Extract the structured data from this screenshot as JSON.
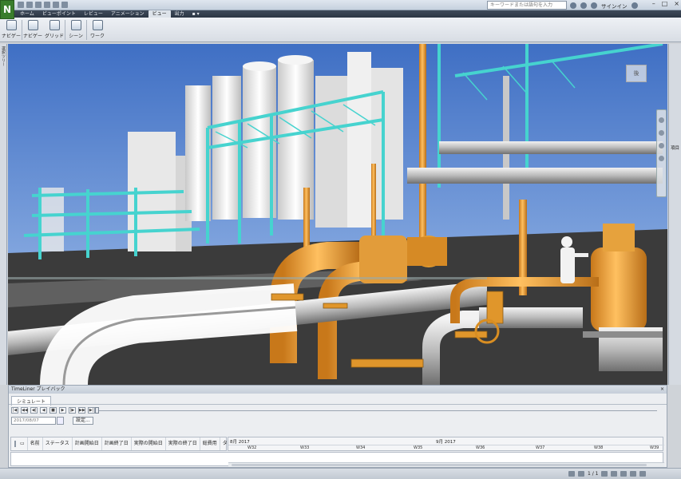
{
  "app": {
    "logo_letter": "N",
    "search_placeholder": "キーワードまたは語句を入力",
    "signin_label": "サインイン",
    "window_controls": [
      "–",
      "□",
      "×"
    ]
  },
  "ribbon_tabs": [
    "ホーム",
    "ビューポイント",
    "レビュー",
    "アニメーション",
    "ビュー",
    "出力"
  ],
  "ribbon_active_tab": "ビュー",
  "ribbon_buttons": [
    {
      "label": "ナビゲー",
      "icon": "hand-icon"
    },
    {
      "label": "ナビゲー",
      "icon": "navigation-bar-icon"
    },
    {
      "label": "グリッド",
      "icon": "grid-icon"
    },
    {
      "label": "シーン",
      "icon": "scene-icon"
    },
    {
      "label": "ワーク",
      "icon": "workspace-icon"
    }
  ],
  "left_dock_label": "選択ツリー",
  "right_dock_label": "項目",
  "viewport": {
    "nav_cube_label": "後"
  },
  "timeliner": {
    "title": "TimeLiner プレイバック",
    "close_label": "×",
    "tab": "シミュレート",
    "playback_buttons": [
      "|◀",
      "◀◀",
      "◀|",
      "◀",
      "■",
      "▶",
      "|▶",
      "▶▶",
      "▶|"
    ],
    "date_value": "2017/08/07",
    "settings_label": "設定...",
    "columns": [
      "名前",
      "ステータス",
      "計画開始日",
      "計画終了日",
      "実際の開始日",
      "実際の終了日",
      "総費用",
      "タスクタイプ"
    ],
    "months": [
      "8月 2017",
      "9月 2017"
    ],
    "weeks": [
      "W32",
      "W33",
      "W34",
      "W35",
      "W36",
      "W37",
      "W38",
      "W39"
    ]
  },
  "status": {
    "page": "1 / 1"
  },
  "colors": {
    "sky_top": "#4a78c8",
    "sky_bottom": "#9fbde8",
    "steel_cyan": "#4fd2d0",
    "pipe_orange": "#f0a030",
    "ground": "#3a3a3a"
  }
}
